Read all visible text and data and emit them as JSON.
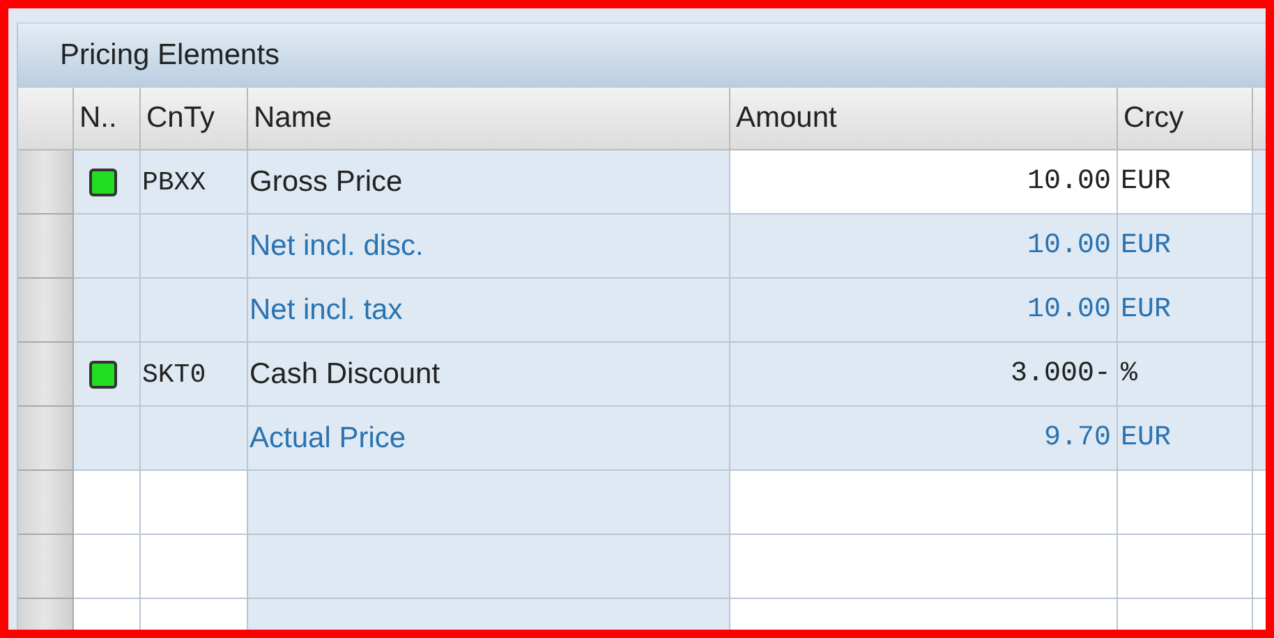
{
  "panel": {
    "title": "Pricing Elements"
  },
  "table": {
    "columns": [
      "N..",
      "CnTy",
      "Name",
      "Amount",
      "Crcy"
    ],
    "rows": [
      {
        "kind": "condition",
        "color": "#22dd22",
        "cnty": "PBXX",
        "name": "Gross Price",
        "amount": "10.00",
        "crcy": "EUR",
        "editable": true
      },
      {
        "kind": "subtotal",
        "name": "Net incl. disc.",
        "amount": "10.00",
        "crcy": "EUR",
        "editable": false
      },
      {
        "kind": "subtotal",
        "name": "Net incl. tax",
        "amount": "10.00",
        "crcy": "EUR",
        "editable": false
      },
      {
        "kind": "condition",
        "color": "#22dd22",
        "cnty": "SKT0",
        "name": "Cash Discount",
        "amount": "3.000-",
        "crcy": "%",
        "editable": false
      },
      {
        "kind": "subtotal",
        "name": "Actual Price",
        "amount": "9.70",
        "crcy": "EUR",
        "editable": false
      },
      {
        "kind": "empty"
      },
      {
        "kind": "empty"
      },
      {
        "kind": "empty"
      }
    ]
  }
}
